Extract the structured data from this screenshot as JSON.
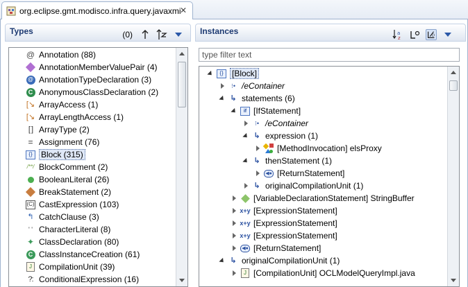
{
  "editor": {
    "tab_title": "org.eclipse.gmt.modisco.infra.query.javaxmi",
    "tab_icon": "model-file-icon",
    "close_glyph": "✕"
  },
  "types_pane": {
    "title": "Types",
    "count": "(0)",
    "items": [
      {
        "label": "Annotation (88)",
        "icon": "annotation-icon"
      },
      {
        "label": "AnnotationMemberValuePair (4)",
        "icon": "annotation-member-icon"
      },
      {
        "label": "AnnotationTypeDeclaration (3)",
        "icon": "annotation-type-icon"
      },
      {
        "label": "AnonymousClassDeclaration (2)",
        "icon": "anonymous-class-icon"
      },
      {
        "label": "ArrayAccess (1)",
        "icon": "array-access-icon"
      },
      {
        "label": "ArrayLengthAccess (1)",
        "icon": "array-length-icon"
      },
      {
        "label": "ArrayType (2)",
        "icon": "array-type-icon"
      },
      {
        "label": "Assignment (76)",
        "icon": "assignment-icon"
      },
      {
        "label": "Block (315)",
        "icon": "block-icon",
        "selected": true
      },
      {
        "label": "BlockComment (2)",
        "icon": "block-comment-icon"
      },
      {
        "label": "BooleanLiteral (26)",
        "icon": "boolean-literal-icon"
      },
      {
        "label": "BreakStatement (2)",
        "icon": "break-statement-icon"
      },
      {
        "label": "CastExpression (103)",
        "icon": "cast-expression-icon"
      },
      {
        "label": "CatchClause (3)",
        "icon": "catch-clause-icon"
      },
      {
        "label": "CharacterLiteral (8)",
        "icon": "character-literal-icon"
      },
      {
        "label": "ClassDeclaration (80)",
        "icon": "class-declaration-icon"
      },
      {
        "label": "ClassInstanceCreation (61)",
        "icon": "class-instance-icon"
      },
      {
        "label": "CompilationUnit (39)",
        "icon": "compilation-unit-icon"
      },
      {
        "label": "ConditionalExpression (16)",
        "icon": "conditional-expression-icon"
      }
    ]
  },
  "instances_pane": {
    "title": "Instances",
    "filter_placeholder": "type filter text",
    "rows": [
      {
        "label": "[Block]",
        "indent": 0,
        "twisty": "open",
        "icon": "block-icon",
        "selected": true
      },
      {
        "label": "/eContainer",
        "indent": 1,
        "twisty": "closed",
        "icon": "container-ref-icon",
        "italic": true
      },
      {
        "label": "statements (6)",
        "indent": 1,
        "twisty": "open",
        "icon": "reference-icon"
      },
      {
        "label": "[IfStatement]",
        "indent": 2,
        "twisty": "open",
        "icon": "if-statement-icon"
      },
      {
        "label": "/eContainer",
        "indent": 3,
        "twisty": "closed",
        "icon": "container-ref-icon",
        "italic": true
      },
      {
        "label": "expression (1)",
        "indent": 3,
        "twisty": "open",
        "icon": "reference-icon"
      },
      {
        "label": "[MethodInvocation] elsProxy",
        "indent": 4,
        "twisty": "closed",
        "icon": "method-invocation-icon"
      },
      {
        "label": "thenStatement (1)",
        "indent": 3,
        "twisty": "open",
        "icon": "reference-icon"
      },
      {
        "label": "[ReturnStatement]",
        "indent": 4,
        "twisty": "closed",
        "icon": "return-statement-icon"
      },
      {
        "label": "originalCompilationUnit (1)",
        "indent": 3,
        "twisty": "closed",
        "icon": "reference-icon"
      },
      {
        "label": "[VariableDeclarationStatement] StringBuffer",
        "indent": 2,
        "twisty": "closed",
        "icon": "variable-declaration-icon"
      },
      {
        "label": "[ExpressionStatement]",
        "indent": 2,
        "twisty": "closed",
        "icon": "expression-statement-icon"
      },
      {
        "label": "[ExpressionStatement]",
        "indent": 2,
        "twisty": "closed",
        "icon": "expression-statement-icon"
      },
      {
        "label": "[ExpressionStatement]",
        "indent": 2,
        "twisty": "closed",
        "icon": "expression-statement-icon"
      },
      {
        "label": "[ReturnStatement]",
        "indent": 2,
        "twisty": "closed",
        "icon": "return-statement-icon"
      },
      {
        "label": "originalCompilationUnit (1)",
        "indent": 1,
        "twisty": "open",
        "icon": "reference-icon"
      },
      {
        "label": "[CompilationUnit] OCLModelQueryImpl.java",
        "indent": 2,
        "twisty": "closed",
        "icon": "compilation-unit-icon"
      }
    ]
  }
}
